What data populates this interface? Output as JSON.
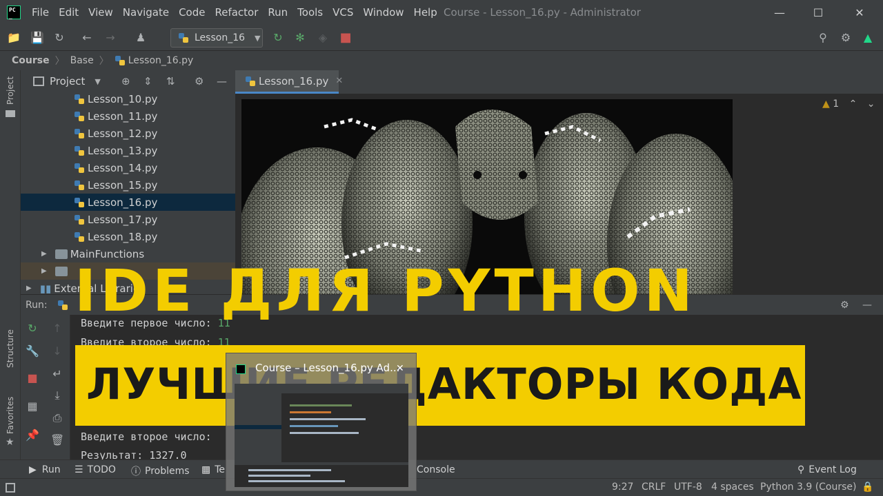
{
  "menu": {
    "items": [
      "File",
      "Edit",
      "View",
      "Navigate",
      "Code",
      "Refactor",
      "Run",
      "Tools",
      "VCS",
      "Window",
      "Help"
    ],
    "window_title": "Course - Lesson_16.py - Administrator"
  },
  "toolbar": {
    "run_config": "Lesson_16"
  },
  "breadcrumb": {
    "items": [
      "Course",
      "Base",
      "Lesson_16.py"
    ]
  },
  "left_stripe": {
    "project": "Project",
    "structure": "Structure",
    "favorites": "Favorites"
  },
  "project": {
    "title": "Project",
    "files": [
      "Lesson_10.py",
      "Lesson_11.py",
      "Lesson_12.py",
      "Lesson_13.py",
      "Lesson_14.py",
      "Lesson_15.py",
      "Lesson_16.py",
      "Lesson_17.py",
      "Lesson_18.py"
    ],
    "folders": [
      "MainFunctions"
    ],
    "external_libraries": "External Libraries"
  },
  "editor": {
    "tab_label": "Lesson_16.py",
    "warning_count": "1"
  },
  "run": {
    "label": "Run:",
    "console_lines": [
      "Введите первое число: ",
      "Введите второе число: ",
      "Введите второе число: ",
      "Результат: 1327.0"
    ],
    "console_values": [
      "11",
      "11"
    ]
  },
  "headline": {
    "title": "IDE ДЛЯ PYTHON",
    "subtitle": "ЛУЧШИЕ РЕДАКТОРЫ КОДА"
  },
  "preview": {
    "title": "Course – Lesson_16.py Ad..."
  },
  "bottom_tabs": {
    "run": "Run",
    "todo": "TODO",
    "problems": "Problems",
    "terminal": "Te",
    "python_console": "Console",
    "event_log": "Event Log"
  },
  "status": {
    "position": "9:27",
    "line_sep": "CRLF",
    "encoding": "UTF-8",
    "indent": "4 spaces",
    "interpreter": "Python 3.9 (Course)"
  },
  "colors": {
    "accent_yellow": "#f3cd00",
    "selection": "#0d293e",
    "panel": "#3c3f41",
    "editor_bg": "#2b2b2b"
  }
}
